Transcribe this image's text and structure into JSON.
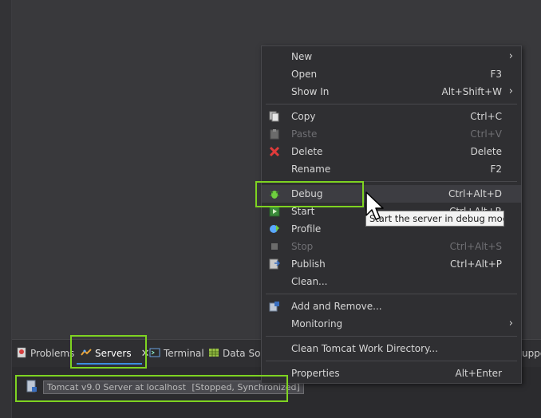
{
  "context_menu": {
    "items": [
      {
        "label": "New",
        "shortcut": "",
        "submenu": true,
        "icon": "none",
        "disabled": false
      },
      {
        "label": "Open",
        "shortcut": "F3",
        "submenu": false,
        "icon": "none",
        "disabled": false
      },
      {
        "label": "Show In",
        "shortcut": "Alt+Shift+W",
        "submenu": true,
        "icon": "none",
        "disabled": false
      },
      {
        "label": "Copy",
        "shortcut": "Ctrl+C",
        "submenu": false,
        "icon": "copy-icon",
        "disabled": false
      },
      {
        "label": "Paste",
        "shortcut": "Ctrl+V",
        "submenu": false,
        "icon": "paste-icon",
        "disabled": true
      },
      {
        "label": "Delete",
        "shortcut": "Delete",
        "submenu": false,
        "icon": "delete-icon",
        "disabled": false
      },
      {
        "label": "Rename",
        "shortcut": "F2",
        "submenu": false,
        "icon": "none",
        "disabled": false
      },
      {
        "label": "Debug",
        "shortcut": "Ctrl+Alt+D",
        "submenu": false,
        "icon": "debug-bug-icon",
        "disabled": false
      },
      {
        "label": "Start",
        "shortcut": "Ctrl+Alt+R",
        "submenu": false,
        "icon": "start-icon",
        "disabled": false
      },
      {
        "label": "Profile",
        "shortcut": "",
        "submenu": false,
        "icon": "profile-icon",
        "disabled": false
      },
      {
        "label": "Stop",
        "shortcut": "Ctrl+Alt+S",
        "submenu": false,
        "icon": "stop-icon",
        "disabled": true
      },
      {
        "label": "Publish",
        "shortcut": "Ctrl+Alt+P",
        "submenu": false,
        "icon": "publish-icon",
        "disabled": false
      },
      {
        "label": "Clean...",
        "shortcut": "",
        "submenu": false,
        "icon": "none",
        "disabled": false
      },
      {
        "label": "Add and Remove...",
        "shortcut": "",
        "submenu": false,
        "icon": "add-remove-icon",
        "disabled": false
      },
      {
        "label": "Monitoring",
        "shortcut": "",
        "submenu": true,
        "icon": "none",
        "disabled": false
      },
      {
        "label": "Clean Tomcat Work Directory...",
        "shortcut": "",
        "submenu": false,
        "icon": "none",
        "disabled": false
      },
      {
        "label": "Properties",
        "shortcut": "Alt+Enter",
        "submenu": false,
        "icon": "none",
        "disabled": false
      }
    ],
    "tooltip": "Start the server in debug mode"
  },
  "views": {
    "tabs": [
      {
        "label": "Problems",
        "icon": "problems-icon"
      },
      {
        "label": "Servers",
        "icon": "servers-icon",
        "active": true
      },
      {
        "label": "Terminal",
        "icon": "terminal-icon"
      },
      {
        "label": "Data Sou",
        "icon": "data-source-icon"
      },
      {
        "label": "uppo",
        "icon": "none"
      }
    ],
    "server_name": "Tomcat v9.0 Server at localhost",
    "server_status": "[Stopped, Synchronized]"
  },
  "colors": {
    "highlight": "#7ed321",
    "accent": "#3b8de0",
    "delete_red": "#e03b3b",
    "debug_green": "#6fcf3f"
  }
}
